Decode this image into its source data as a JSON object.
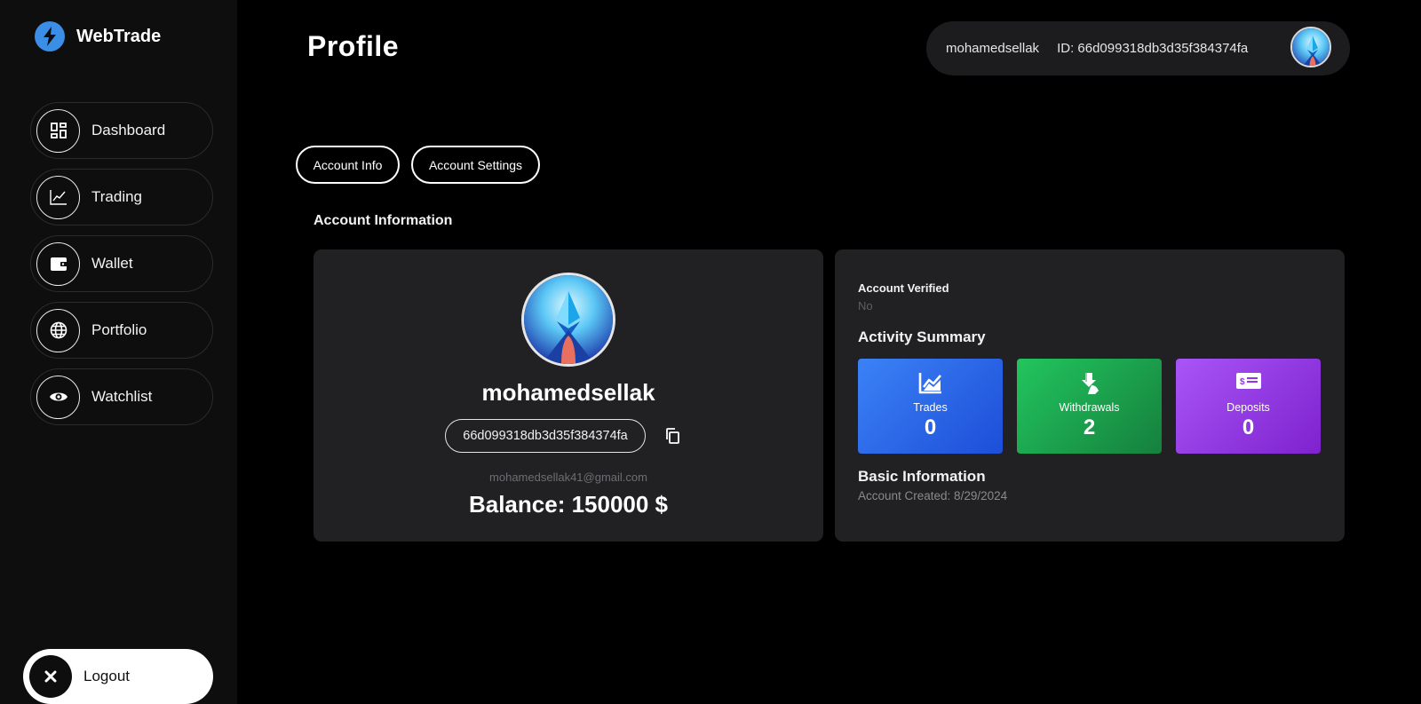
{
  "brand": {
    "name": "WebTrade",
    "icon": "lightning-bolt-icon",
    "accent": "#3a8ee6"
  },
  "sidebar": {
    "items": [
      {
        "label": "Dashboard",
        "icon": "dashboard-grid-icon"
      },
      {
        "label": "Trading",
        "icon": "line-chart-icon"
      },
      {
        "label": "Wallet",
        "icon": "wallet-icon"
      },
      {
        "label": "Portfolio",
        "icon": "globe-icon"
      },
      {
        "label": "Watchlist",
        "icon": "eye-icon"
      }
    ],
    "logout": {
      "label": "Logout",
      "icon": "close-icon"
    }
  },
  "header": {
    "title": "Profile",
    "username": "mohamedsellak",
    "id_text": "ID: 66d099318db3d35f384374fa"
  },
  "tabs": [
    {
      "label": "Account Info"
    },
    {
      "label": "Account Settings"
    }
  ],
  "section_title": "Account Information",
  "profile": {
    "name": "mohamedsellak",
    "id": "66d099318db3d35f384374fa",
    "email": "mohamedsellak41@gmail.com",
    "balance": "Balance: 150000 $"
  },
  "account": {
    "verified_label": "Account Verified",
    "verified_value": "No",
    "activity_title": "Activity Summary",
    "stats": [
      {
        "label": "Trades",
        "value": "0",
        "icon": "trend-chart-icon",
        "color": "#2f6fe8"
      },
      {
        "label": "Withdrawals",
        "value": "2",
        "icon": "download-hand-icon",
        "color": "#1da94d"
      },
      {
        "label": "Deposits",
        "value": "0",
        "icon": "money-check-icon",
        "color": "#9333ea"
      }
    ],
    "basic_title": "Basic Information",
    "created": "Account Created: 8/29/2024"
  }
}
